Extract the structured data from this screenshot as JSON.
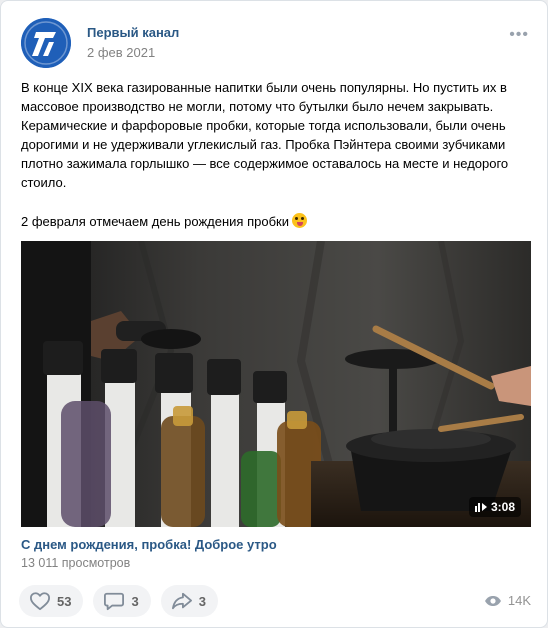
{
  "post": {
    "author": "Первый канал",
    "date": "2 фев 2021",
    "more_icon": "more-horizontal-icon",
    "text_main": "В конце XIX века газированные напитки были очень популярны. Но пустить их в массовое производство не могли, потому что бутылки было нечем закрывать. Керамические и фарфоровые пробки, которые тогда использовали, были очень дорогими и не удерживали углекислый газ. Пробка Пэйнтера своими зубчиками плотно зажимала горлышко — все содержимое оставалось на месте и недорого стоило.",
    "text_second": "2 февраля отмечаем день рождения пробки",
    "emoji_icon": "grinning-tongue-emoji-icon"
  },
  "video": {
    "duration": "3:08",
    "title": "С днем рождения, пробка! Доброе утро",
    "views": "13 011 просмотров"
  },
  "actions": {
    "likes": "53",
    "comments": "3",
    "shares": "3",
    "views": "14K"
  },
  "colors": {
    "link": "#2a5885",
    "muted": "#828282",
    "button_bg": "#f2f3f5",
    "brand": "#2a6bc4"
  }
}
